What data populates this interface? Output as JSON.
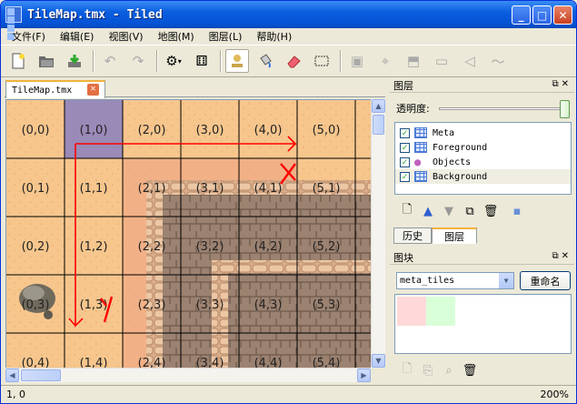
{
  "window": {
    "title": "TileMap.tmx - Tiled",
    "minimize": "_",
    "maximize": "□",
    "close": "✕"
  },
  "menu": [
    "文件(F)",
    "编辑(E)",
    "视图(V)",
    "地图(M)",
    "图层(L)",
    "帮助(H)"
  ],
  "toolbar": {
    "icons": [
      "new-file-icon",
      "open-folder-icon",
      "save-icon",
      "undo-icon",
      "redo-icon",
      "settings-icon",
      "dice-icon",
      "stamp-brush-icon",
      "bucket-fill-icon",
      "eraser-icon",
      "rect-select-icon",
      "object-select-icon",
      "polygon-icon",
      "insert-tile-icon",
      "insert-image-icon",
      "insert-polygon-icon",
      "insert-polyline-icon"
    ]
  },
  "document": {
    "tab_label": "TileMap.tmx",
    "tab_close": "✕"
  },
  "map": {
    "columns": 6,
    "cell_labels": [
      [
        "(0,0)",
        "(1,0)",
        "(2,0)",
        "(3,0)",
        "(4,0)",
        "(5,0)"
      ],
      [
        "(0,1)",
        "(1,1)",
        "(2,1)",
        "(3,1)",
        "(4,1)",
        "(5,1)"
      ],
      [
        "(0,2)",
        "(1,2)",
        "(2,2)",
        "(3,2)",
        "(4,2)",
        "(5,2)"
      ],
      [
        "(0,3)",
        "(1,3)",
        "(2,3)",
        "(3,3)",
        "(4,3)",
        "(5,3)"
      ],
      [
        "(0,4)",
        "(1,4)",
        "(2,4)",
        "(3,4)",
        "(4,4)",
        "(5,4)"
      ]
    ],
    "meta_tile_color": "#9a8ab8",
    "sand_color": "#f6c68d",
    "stone_color": "#9c8270",
    "annotation_color": "#ff0000",
    "annotation_marks": [
      "X",
      "Y"
    ]
  },
  "layers_panel": {
    "title": "图层",
    "opacity_label": "透明度:",
    "opacity_value": 1.0,
    "layers": [
      {
        "name": "Meta",
        "visible": "✓",
        "icon": "tile-layer-icon"
      },
      {
        "name": "Foreground",
        "visible": "✓",
        "icon": "tile-layer-icon"
      },
      {
        "name": "Objects",
        "visible": "✓",
        "icon": "object-layer-icon"
      },
      {
        "name": "Background",
        "visible": "✓",
        "icon": "tile-layer-icon"
      }
    ],
    "tab_history": "历史",
    "tab_layers": "图层"
  },
  "tilesets_panel": {
    "title": "图块",
    "selected_tileset": "meta_tiles",
    "rename_button": "重命名",
    "tile_colors": [
      "#ffd9d9",
      "#d9ffd9"
    ]
  },
  "status": {
    "coords": "1, 0",
    "zoom": "200%"
  }
}
